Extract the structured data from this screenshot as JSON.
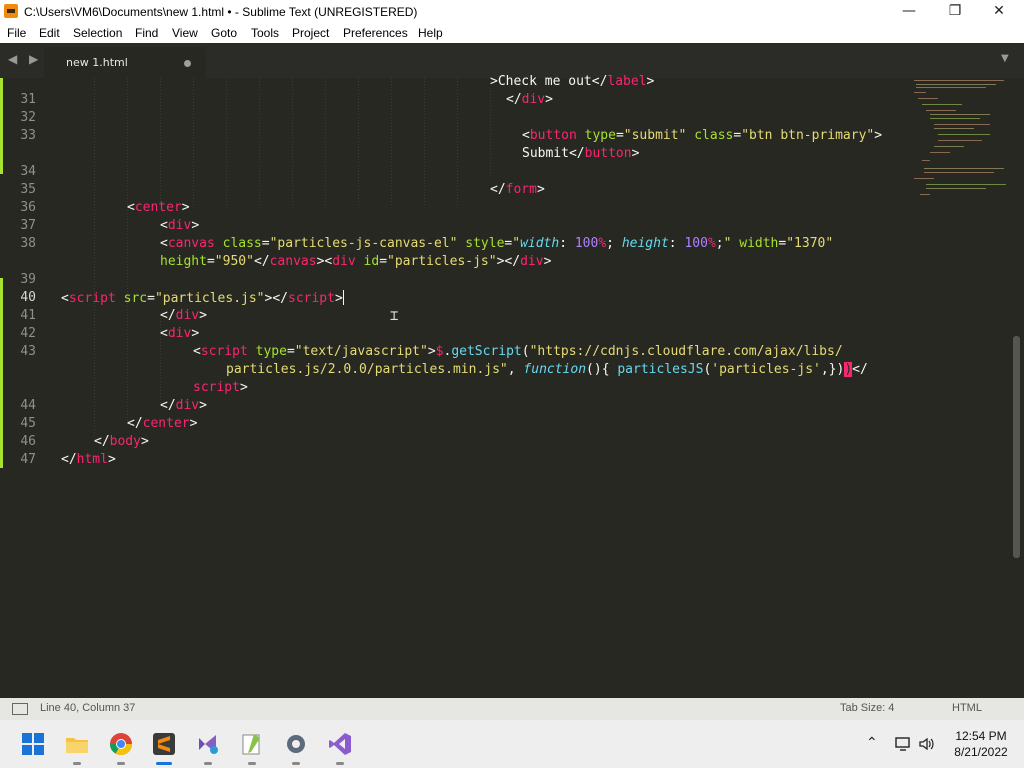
{
  "window": {
    "title": "C:\\Users\\VM6\\Documents\\new 1.html • - Sublime Text (UNREGISTERED)",
    "minimize": "—",
    "maximize": "❐",
    "close": "✕"
  },
  "menu": [
    "File",
    "Edit",
    "Selection",
    "Find",
    "View",
    "Goto",
    "Tools",
    "Project",
    "Preferences",
    "Help"
  ],
  "tabs": {
    "nav": "◀ ▶",
    "active_tab": "new 1.html",
    "dropdown": "▼"
  },
  "editor": {
    "line_numbers": [
      "31",
      "32",
      "33",
      "34",
      "35",
      "36",
      "37",
      "38",
      "39",
      "40",
      "41",
      "42",
      "43",
      "44",
      "45",
      "46",
      "47"
    ],
    "current_line": "40",
    "frag": {
      "check_me_out": ">Check me out</",
      "label": "label",
      "gt": ">",
      "lt": "<",
      "close_lt": "</",
      "div": "div",
      "button": "button",
      "type_attr": " type",
      "eq": "=",
      "submit_val": "\"submit\"",
      "class_attr": " class",
      "btn_val": "\"btn btn-primary\"",
      "submit_text": "Submit",
      "form": "form",
      "center": "center",
      "canvas": "canvas",
      "canvas_class_val": "\"particles-js-canvas-el\"",
      "style_attr": " style",
      "q": "\"",
      "width": "width",
      "colon_sp": ": ",
      "p100": "100",
      "pct": "%",
      "semi_sp": "; ",
      "height": "height",
      "semi": ";",
      "width_attr": " width",
      "width_val": "\"1370\"",
      "height_attr": "height",
      "height_val": "\"950\"",
      "div_id_attr": " id",
      "div_id_val": "\"particles-js\"",
      "script": "script",
      "src_attr": " src",
      "src_val": "\"particles.js\"",
      "type_js_val": "\"text/javascript\"",
      "dollar": "$",
      "dot": ".",
      "getScript": "getScript",
      "paren_open": "(",
      "url1": "\"https://cdnjs.cloudflare.com/ajax/libs/",
      "url2": "particles.js/2.0.0/particles.min.js\"",
      "comma_sp": ", ",
      "function": "function",
      "fn_sig": "(){ ",
      "particlesJS": "particlesJS",
      "pjs_arg": "'particles-js'",
      "comma_brace": ",})",
      "close_paren": ")",
      "body": "body",
      "html": "html"
    }
  },
  "status": {
    "position": "Line 40, Column 37",
    "tab_size": "Tab Size: 4",
    "syntax": "HTML"
  },
  "taskbar": {
    "tray": "⌃",
    "time": "12:54 PM",
    "date": "8/21/2022"
  },
  "colors": {
    "editor_bg": "#272822",
    "tag": "#f92672",
    "attr": "#a6e22e",
    "string": "#e6db74",
    "number": "#ae81ff",
    "keyword": "#66d9ef"
  }
}
